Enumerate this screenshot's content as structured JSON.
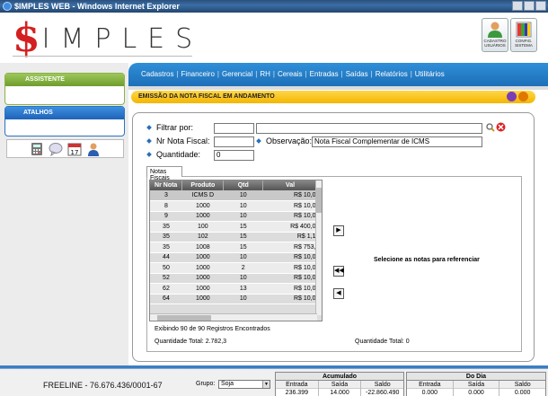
{
  "window": {
    "title": "$IMPLES WEB - Windows Internet Explorer"
  },
  "header": {
    "logo_symbol": "$",
    "logo_word": "IMPLES",
    "cadastro_label": "CADASTRO USUÁRIOS",
    "config_label": "CONFIG. SISTEMA"
  },
  "nav": {
    "items": [
      "Cadastros",
      "Financeiro",
      "Gerencial",
      "RH",
      "Cereais",
      "Entradas",
      "Saídas",
      "Relatórios",
      "Utilitários"
    ]
  },
  "sidebar": {
    "assistente": "ASSISTENTE",
    "atalhos": "ATALHOS"
  },
  "banner": {
    "title": "EMISSÃO DA NOTA FISCAL EM ANDAMENTO"
  },
  "form": {
    "filtrar_label": "Filtrar por:",
    "filtrar_value1": "",
    "filtrar_value2": "",
    "nr_nota_label": "Nr Nota Fiscal:",
    "nr_nota_value": "",
    "observacao_label": "Observação:",
    "observacao_value": "Nota Fiscal Complementar de ICMS",
    "quantidade_label": "Quantidade:",
    "quantidade_value": "0"
  },
  "tabs": {
    "notas_fiscais": "Notas Fiscais"
  },
  "grid": {
    "headers": [
      "Nr Nota",
      "Produto",
      "Qtd",
      "Val"
    ],
    "rows": [
      [
        "3",
        "ICMS D",
        "10",
        "R$ 10,0"
      ],
      [
        "8",
        "1000",
        "10",
        "R$ 10,0"
      ],
      [
        "9",
        "1000",
        "10",
        "R$ 10,0"
      ],
      [
        "35",
        "100",
        "15",
        "R$ 400,0"
      ],
      [
        "35",
        "102",
        "15",
        "R$ 1,1"
      ],
      [
        "35",
        "1008",
        "15",
        "R$ 753,"
      ],
      [
        "44",
        "1000",
        "10",
        "R$ 10,0"
      ],
      [
        "50",
        "1000",
        "2",
        "R$ 10,0"
      ],
      [
        "52",
        "1000",
        "10",
        "R$ 10,0"
      ],
      [
        "62",
        "1000",
        "13",
        "R$ 10,0"
      ],
      [
        "64",
        "1000",
        "10",
        "R$ 10,0"
      ]
    ],
    "registros": "Exibindo 90 de 90 Registros Encontrados",
    "quantidade_total_left": "Quantidade Total: 2.782,3",
    "quantidade_total_right": "Quantidade Total: 0",
    "selecione": "Selecione as notas para referenciar"
  },
  "status": {
    "freeline": "FREELINE - 76.676.436/0001-67",
    "grupo_label": "Grupo:",
    "grupo_value": "Soja",
    "acumulado_title": "Acumulado",
    "acumulado": {
      "entrada_label": "Entrada",
      "saida_label": "Saída",
      "saldo_label": "Saldo",
      "entrada": "236.399",
      "saida": "14.000",
      "saldo": "-22.860.490"
    },
    "dodia_title": "Do Dia",
    "dodia": {
      "entrada_label": "Entrada",
      "saida_label": "Saída",
      "saldo_label": "Saldo",
      "entrada": "0.000",
      "saida": "0.000",
      "saldo": "0.000"
    }
  },
  "colors": {
    "brand_red": "#d42020",
    "nav_blue": "#1d6fb8",
    "banner_yellow": "#f3b600",
    "assist_green": "#6f9c2c"
  }
}
